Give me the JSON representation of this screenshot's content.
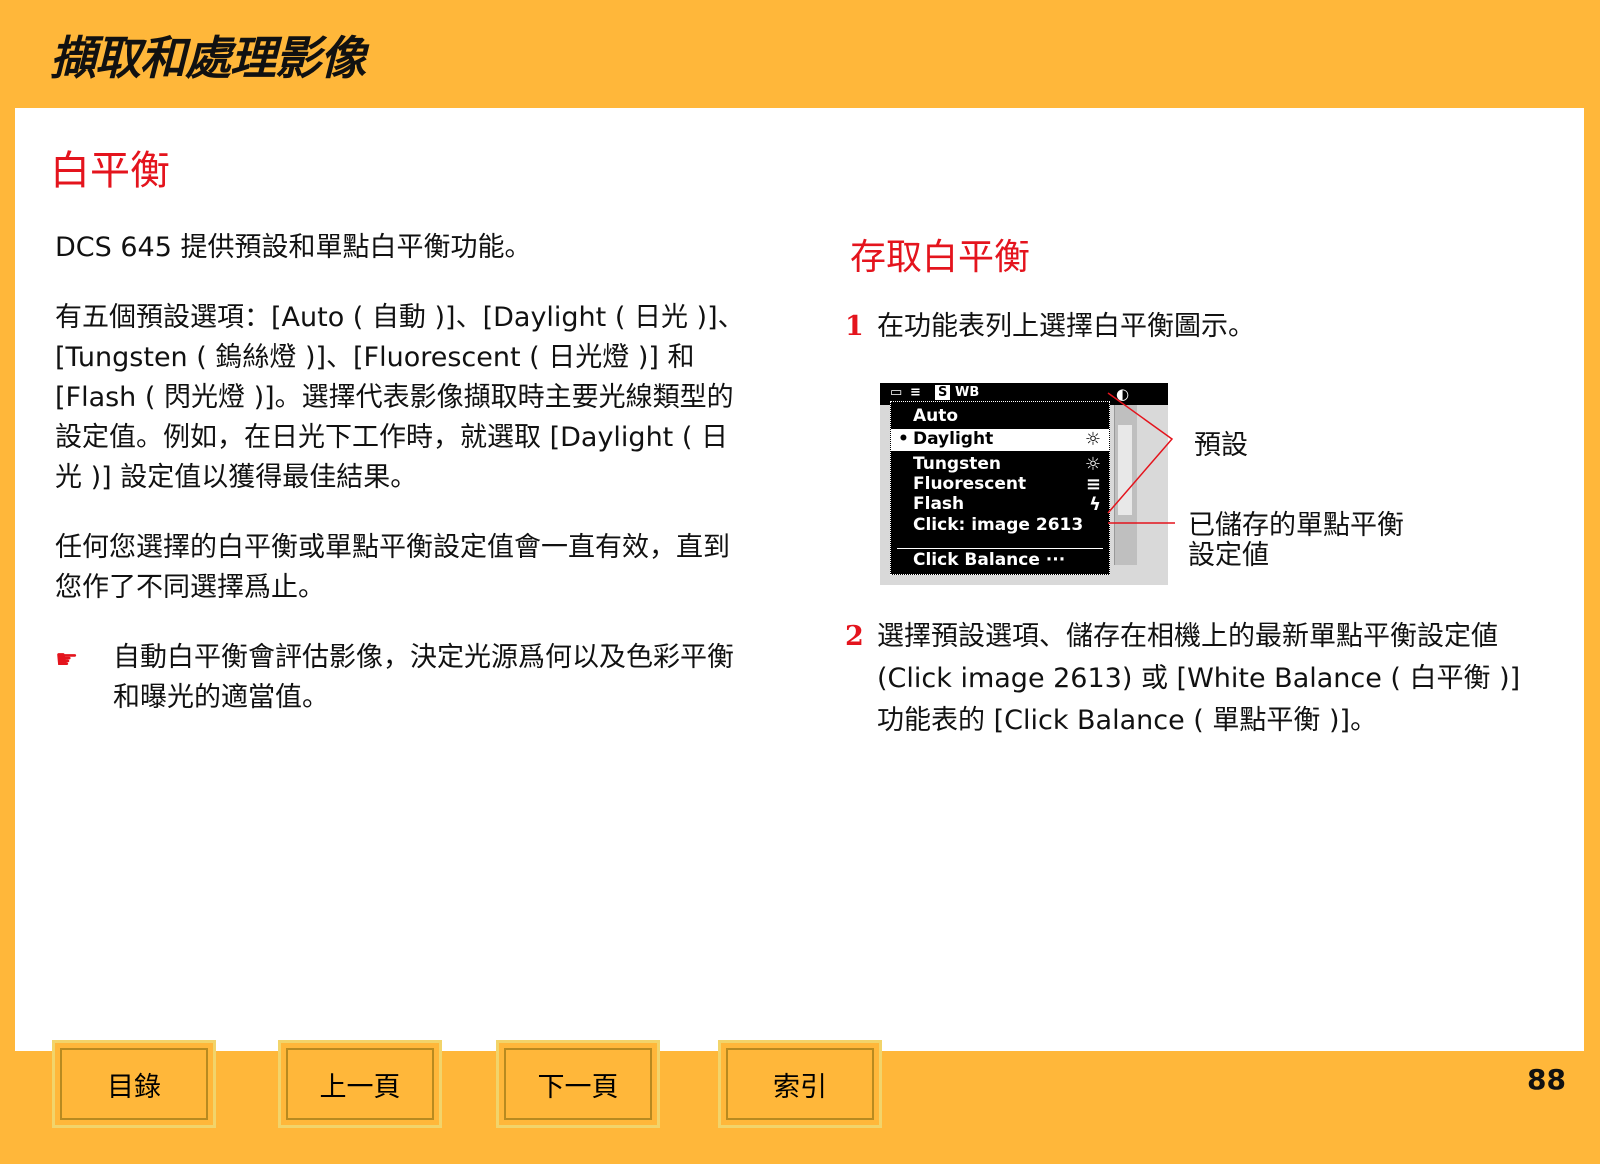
{
  "header": {
    "title": "擷取和處理影像"
  },
  "section_title": "白平衡",
  "left": {
    "para1": "DCS 645 提供預設和單點白平衡功能。",
    "para2": "有五個預設選項：[Auto ( 自動 )]、[Daylight ( 日光 )]、[Tungsten ( 鎢絲燈 )]、[Fluorescent ( 日光燈 )] 和 [Flash ( 閃光燈 )]。選擇代表影像擷取時主要光線類型的設定值。例如，在日光下工作時，就選取 [Daylight ( 日光 )] 設定值以獲得最佳結果。",
    "para3": "任何您選擇的白平衡或單點平衡設定值會一直有效，直到您作了不同選擇爲止。",
    "tip_icon": "☛",
    "tip": "自動白平衡會評估影像，決定光源爲何以及色彩平衡和曝光的適當值。"
  },
  "right": {
    "title": "存取白平衡",
    "step1": {
      "num": "1",
      "text": "在功能表列上選擇白平衡圖示。"
    },
    "step2": {
      "num": "2",
      "text": "選擇預設選項、儲存在相機上的最新單點平衡設定値 (Click image 2613) 或 [White Balance ( 白平衡 )] 功能表的 [Click Balance ( 單點平衡 )]。"
    }
  },
  "figure": {
    "topbar": {
      "s": "S",
      "wb": "WB"
    },
    "items": [
      {
        "label": "Auto",
        "icon": "",
        "bullet": ""
      },
      {
        "label": "Daylight",
        "icon": "☼",
        "bullet": "•"
      },
      {
        "label": "Tungsten",
        "icon": "☼",
        "bullet": ""
      },
      {
        "label": "Fluorescent",
        "icon": "≡",
        "bullet": ""
      },
      {
        "label": "Flash",
        "icon": "ϟ",
        "bullet": ""
      },
      {
        "label": "Click: image 2613",
        "icon": "",
        "bullet": ""
      }
    ],
    "click_balance": "Click Balance ···",
    "callout_presets": "預設",
    "callout_saved": "已儲存的單點平衡設定値"
  },
  "footer": {
    "buttons": [
      "目錄",
      "上一頁",
      "下一頁",
      "索引"
    ],
    "page_number": "88"
  }
}
